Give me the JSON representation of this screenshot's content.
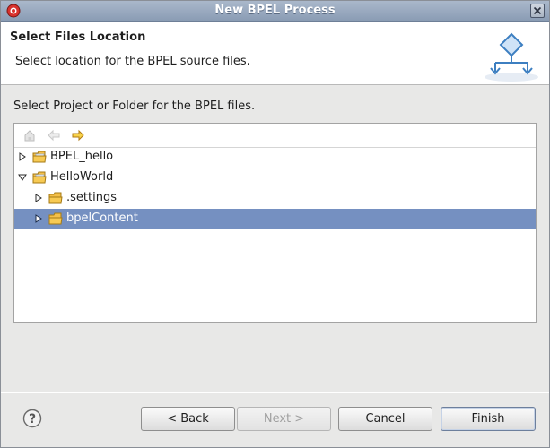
{
  "window": {
    "title": "New BPEL Process"
  },
  "header": {
    "title": "Select Files Location",
    "description": "Select location for the BPEL source files."
  },
  "body": {
    "prompt": "Select Project or Folder for the BPEL files."
  },
  "tree": {
    "toolbar": [
      "home-icon",
      "back-arrow-icon",
      "forward-arrow-icon"
    ],
    "rows": [
      {
        "label": "BPEL_hello",
        "depth": 0,
        "expanded": false,
        "selected": false
      },
      {
        "label": "HelloWorld",
        "depth": 0,
        "expanded": true,
        "selected": false
      },
      {
        "label": ".settings",
        "depth": 1,
        "expanded": false,
        "selected": false
      },
      {
        "label": "bpelContent",
        "depth": 1,
        "expanded": false,
        "selected": true
      }
    ]
  },
  "buttons": {
    "back": "< Back",
    "next": "Next >",
    "cancel": "Cancel",
    "finish": "Finish"
  },
  "colors": {
    "selection": "#7590c1",
    "folder": "#f4c04a",
    "title_bar": "#8a9cb4"
  }
}
